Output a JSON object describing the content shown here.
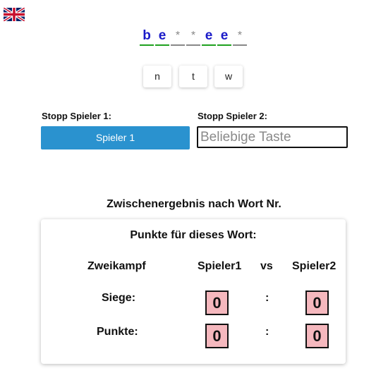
{
  "language_flag": {
    "icon": "uk-flag-icon"
  },
  "word": {
    "slots": [
      {
        "char": "b",
        "state": "revealed"
      },
      {
        "char": "e",
        "state": "revealed"
      },
      {
        "char": "*",
        "state": "hidden"
      },
      {
        "char": "*",
        "state": "hidden"
      },
      {
        "char": "e",
        "state": "revealed"
      },
      {
        "char": "e",
        "state": "revealed"
      },
      {
        "char": "*",
        "state": "hidden"
      }
    ]
  },
  "letters": [
    "n",
    "t",
    "w"
  ],
  "stop": {
    "player1_label": "Stopp Spieler 1:",
    "player2_label": "Stopp Spieler 2:",
    "player1_button": "Spieler 1",
    "player2_placeholder": "Beliebige Taste"
  },
  "result": {
    "title": "Zwischenergebnis nach Wort Nr.",
    "card_title": "Punkte für dieses Wort:",
    "header": {
      "col0": "Zweikampf",
      "col1": "Spieler1",
      "vs": "vs",
      "col2": "Spieler2"
    },
    "rows": [
      {
        "label": "Siege:",
        "p1": "0",
        "sep": ":",
        "p2": "0"
      },
      {
        "label": "Punkte:",
        "p1": "0",
        "sep": ":",
        "p2": "0"
      }
    ]
  },
  "colors": {
    "revealed_letter": "#1a1ac8",
    "revealed_underline": "#1fa11f",
    "player_button": "#2a92cf",
    "score_box": "#f5b8be"
  }
}
